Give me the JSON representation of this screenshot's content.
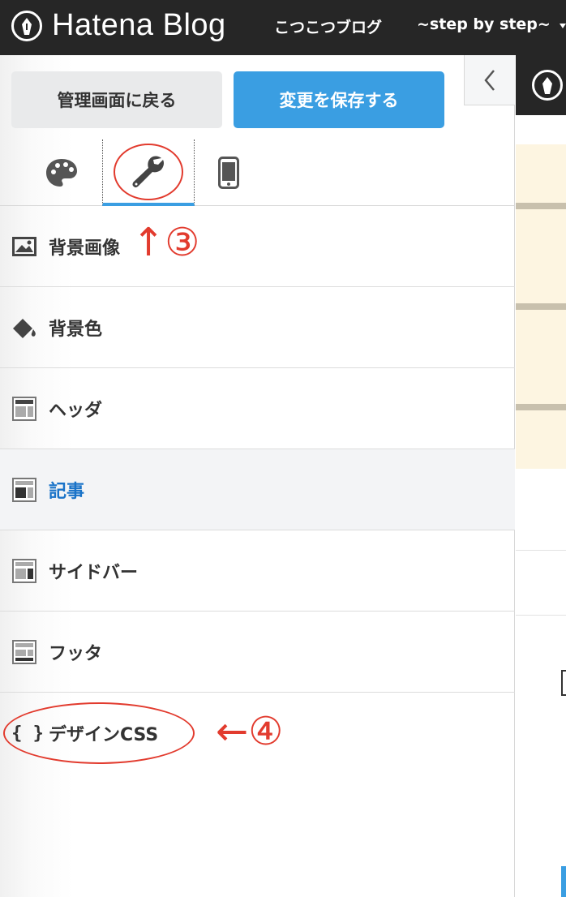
{
  "topbar": {
    "logo_text": "Hatena Blog",
    "blog_title": "こつこつブログ",
    "blog_subtitle": "~step by step~"
  },
  "sidebar": {
    "back_button": "管理画面に戻る",
    "save_button": "変更を保存する",
    "tabs": [
      {
        "icon": "palette-icon"
      },
      {
        "icon": "wrench-icon",
        "active": true
      },
      {
        "icon": "smartphone-icon"
      }
    ],
    "menu": [
      {
        "label": "背景画像",
        "icon": "image-icon"
      },
      {
        "label": "背景色",
        "icon": "paint-bucket-icon"
      },
      {
        "label": "ヘッダ",
        "icon": "layout-header-icon"
      },
      {
        "label": "記事",
        "icon": "layout-article-icon",
        "active": true
      },
      {
        "label": "サイドバー",
        "icon": "layout-sidebar-icon"
      },
      {
        "label": "フッタ",
        "icon": "layout-footer-icon"
      },
      {
        "label": "デザインCSS",
        "icon": "braces-icon"
      }
    ]
  },
  "annotations": {
    "step3": "↑③",
    "step4": "←④"
  },
  "colors": {
    "accent": "#3a9ee2",
    "active_text": "#1a73c8",
    "annotation": "#e23b2e",
    "topbar_bg": "#262626"
  }
}
